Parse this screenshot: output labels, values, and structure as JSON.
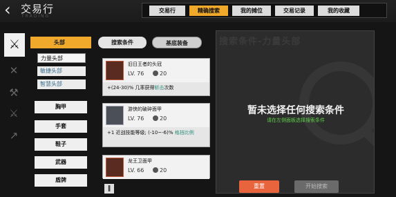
{
  "header": {
    "title": "交易行",
    "subtitle": "TRADING",
    "tabs": [
      {
        "label": "交易行",
        "active": false
      },
      {
        "label": "精确搜索",
        "active": true
      },
      {
        "label": "我的摊位",
        "active": false
      },
      {
        "label": "交易记录",
        "active": false
      },
      {
        "label": "我的收藏",
        "active": false
      }
    ]
  },
  "sidebar_icons": [
    "sword-icon",
    "crossed-swords-icon",
    "daggers-icon",
    "blade-icon",
    "spear-icon"
  ],
  "categories": {
    "expanded": "头部",
    "sub_items": [
      "力量头部",
      "敏捷头部",
      "智慧头部"
    ],
    "active_sub": "力量头部",
    "items": [
      "胸甲",
      "手套",
      "鞋子",
      "武器",
      "盾牌"
    ]
  },
  "filter_tabs": [
    "搜索条件",
    "基底装备"
  ],
  "items": [
    {
      "name": "旧日王者的头冠",
      "level": "LV. 76",
      "price": "20",
      "stat_prefix": "+(24-30)% 几率获得",
      "stat_highlight": "斩击",
      "stat_suffix": "次数"
    },
    {
      "name": "游侠的破碎面甲",
      "level": "LV. 76",
      "price": "20",
      "stat_prefix": "+1 近战技能等级; (-10~-6)% ",
      "stat_highlight": "格挡比例",
      "stat_suffix": ""
    },
    {
      "name": "龙王卫面甲",
      "level": "LV. 66",
      "price": "20",
      "stat_prefix": "",
      "stat_highlight": "",
      "stat_suffix": ""
    }
  ],
  "right_panel": {
    "title": "搜索条件-力量头部",
    "empty_text": "暂未选择任何搜索条件",
    "hint": "请在左侧面板选择搜索条件",
    "reset_label": "重置",
    "search_label": "开始搜索"
  },
  "colors": {
    "accent": "#f0a92a",
    "reset": "#e8643c",
    "hint_green": "#5fcf4a"
  }
}
